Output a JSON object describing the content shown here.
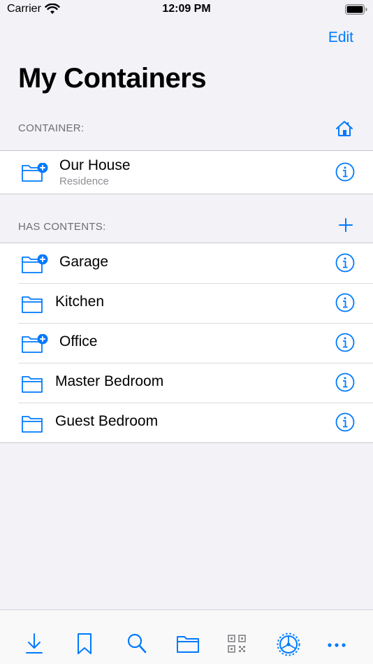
{
  "status": {
    "carrier": "Carrier",
    "time": "12:09 PM"
  },
  "nav": {
    "edit_label": "Edit",
    "title": "My Containers"
  },
  "container_section": {
    "header": "CONTAINER:",
    "item": {
      "name": "Our House",
      "subtitle": "Residence"
    }
  },
  "contents_section": {
    "header": "HAS CONTENTS:",
    "items": [
      {
        "name": "Garage",
        "has_contents": true
      },
      {
        "name": "Kitchen",
        "has_contents": false
      },
      {
        "name": "Office",
        "has_contents": true
      },
      {
        "name": "Master Bedroom",
        "has_contents": false
      },
      {
        "name": "Guest Bedroom",
        "has_contents": false
      }
    ]
  },
  "tab_bar": {
    "items": [
      "download-icon",
      "bookmark-icon",
      "search-icon",
      "folder-icon",
      "qr-code-icon",
      "settings-wheel-icon",
      "more-icon"
    ]
  },
  "colors": {
    "accent": "#007aff",
    "background": "#f2f2f7",
    "secondary_text": "#8e8e93"
  }
}
